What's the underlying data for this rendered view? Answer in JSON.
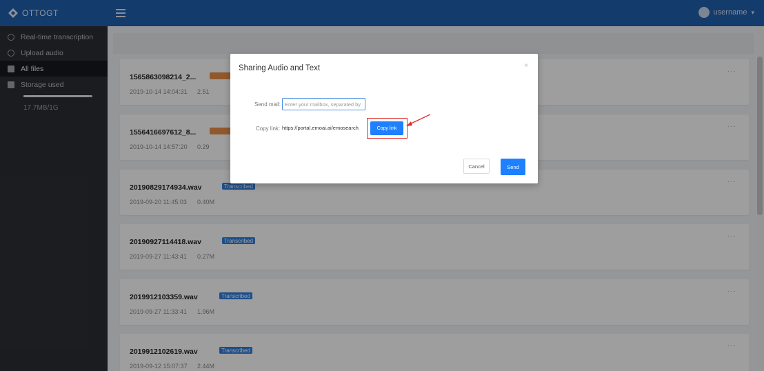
{
  "app": {
    "logo_text": "OTTOGT",
    "username": "username",
    "colors": {
      "topbar": "#1f5fae",
      "sidebar": "#2b2e33",
      "accent": "#1e80ff",
      "highlight": "#e03030"
    }
  },
  "sidebar": {
    "items": [
      {
        "label": "Real-time transcription",
        "icon": "clock-icon"
      },
      {
        "label": "Upload audio",
        "icon": "upload-icon"
      },
      {
        "label": "All files",
        "icon": "files-icon"
      },
      {
        "label": "Storage used",
        "icon": "storage-icon"
      }
    ],
    "storage_value": "17.7MB/1G",
    "storage_fraction": 0.95
  },
  "files": [
    {
      "name": "1565863098214_2...",
      "badge": "",
      "date": "2019-10-14 14:04:31",
      "size": "2.51"
    },
    {
      "name": "1556416697612_8...",
      "badge": "",
      "date": "2019-10-14 14:57:20",
      "size": "0.29"
    },
    {
      "name": "20190829174934.wav",
      "badge": "Transcribed",
      "date": "2019-09-20 11:45:03",
      "size": "0.40M"
    },
    {
      "name": "20190927114418.wav",
      "badge": "Transcribed",
      "date": "2019-09-27 11:43:41",
      "size": "0.27M"
    },
    {
      "name": "2019912103359.wav",
      "badge": "Transcribed",
      "date": "2019-09-27 11:33:41",
      "size": "1.96M"
    },
    {
      "name": "2019912102619.wav",
      "badge": "Transcribed",
      "date": "2019-09-12 15:07:37",
      "size": "2.44M"
    }
  ],
  "modal": {
    "title": "Sharing Audio and Text",
    "close": "×",
    "email_label": "Send mail:",
    "email_placeholder": "Enter your mailbox, separated by",
    "link_label": "Copy link:",
    "link_value": "https://portal.emoai.ai/emosearch",
    "copy_button": "Copy link",
    "cancel_button": "Cancel",
    "send_button": "Send"
  }
}
